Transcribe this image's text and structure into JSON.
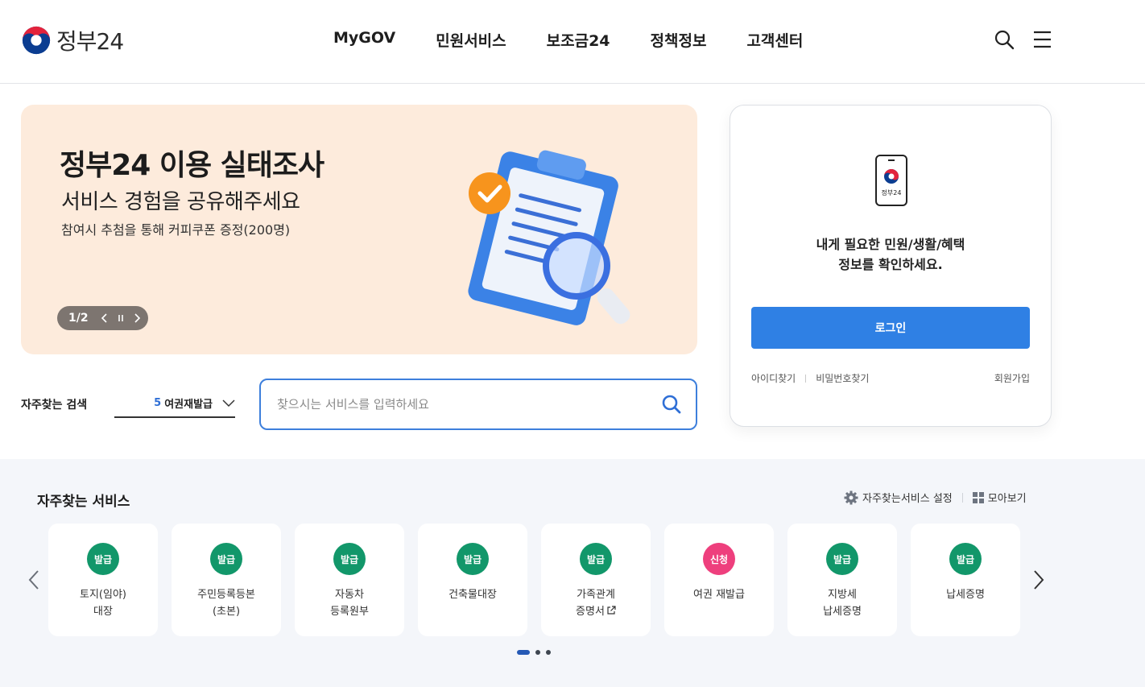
{
  "header": {
    "logo_text": "정부24",
    "nav": [
      "MyGOV",
      "민원서비스",
      "보조금24",
      "정책정보",
      "고객센터"
    ]
  },
  "banner": {
    "title": "정부24 이용 실태조사",
    "subtitle": "서비스 경험을 공유해주세요",
    "description": "참여시 추첨을 통해 커피쿠폰 증정(200명)",
    "page_indicator": "1/2",
    "bg_color": "#fdebdc"
  },
  "login": {
    "phone_label": "정부24",
    "message_line1": "내게 필요한 민원/생활/혜택",
    "message_line2": "정보를 확인하세요.",
    "login_button": "로그인",
    "find_id": "아이디찾기",
    "find_password": "비밀번호찾기",
    "signup": "회원가입",
    "button_color": "#2f80e4"
  },
  "search": {
    "label": "자주찾는 검색",
    "keyword_rank": "5",
    "keyword_text": "여권재발급",
    "placeholder": "찾으시는 서비스를 입력하세요"
  },
  "services": {
    "title": "자주찾는 서비스",
    "settings_label": "자주찾는서비스 설정",
    "view_all_label": "모아보기",
    "items": [
      {
        "badge": "발급",
        "color": "green",
        "label": "토지(임야)\n대장"
      },
      {
        "badge": "발급",
        "color": "green",
        "label": "주민등록등본\n(초본)"
      },
      {
        "badge": "발급",
        "color": "green",
        "label": "자동차\n등록원부"
      },
      {
        "badge": "발급",
        "color": "green",
        "label": "건축물대장"
      },
      {
        "badge": "발급",
        "color": "green",
        "label": "가족관계\n증명서"
      },
      {
        "badge": "신청",
        "color": "pink",
        "label": "여권 재발급"
      },
      {
        "badge": "발급",
        "color": "green",
        "label": "지방세\n납세증명"
      },
      {
        "badge": "발급",
        "color": "green",
        "label": "납세증명"
      }
    ]
  }
}
